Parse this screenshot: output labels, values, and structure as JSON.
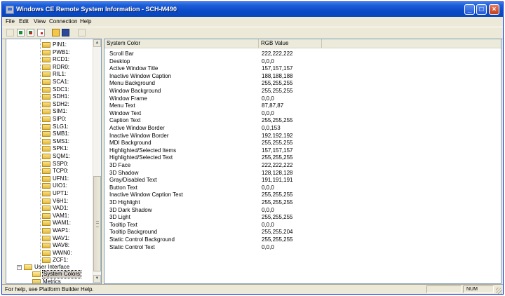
{
  "window": {
    "title": "Windows CE Remote System Information - SCH-M490",
    "controls": {
      "minimize": "_",
      "maximize": "□",
      "close": "×"
    },
    "titlebar_color": "#0a4ac8"
  },
  "menu": [
    {
      "label": "File"
    },
    {
      "label": "Edit"
    },
    {
      "label": "View"
    },
    {
      "label": "Connection"
    },
    {
      "label": "Help"
    }
  ],
  "toolbar": {
    "buttons": [
      "new-icon",
      "connect-icon",
      "disconnect-icon",
      "refresh-icon",
      "open-folder-icon",
      "save-icon",
      "copy-icon"
    ]
  },
  "tree": {
    "items": [
      "PIN1:",
      "PWB1:",
      "RCD1:",
      "RDR0:",
      "RIL1:",
      "SCA1:",
      "SDC1:",
      "SDH1:",
      "SDH2:",
      "SIM1:",
      "SIP0:",
      "SLG1:",
      "SMB1:",
      "SMS1:",
      "SPK1:",
      "SQM1:",
      "SSP0:",
      "TCP0:",
      "UFN1:",
      "UIO1:",
      "UPT1:",
      "V6H1:",
      "VAD1:",
      "VAM1:",
      "WAM1:",
      "WAP1:",
      "WAV1:",
      "WAV8:",
      "WWN0:",
      "ZCF1:"
    ],
    "group": {
      "label": "User Interface",
      "expander": "−"
    },
    "children": [
      {
        "label": "System Colors",
        "selected": true
      },
      {
        "label": "Metrics",
        "selected": false
      }
    ]
  },
  "list": {
    "columns": [
      "System Color",
      "RGB Value"
    ],
    "rows": [
      {
        "name": "Scroll Bar",
        "value": "222,222,222"
      },
      {
        "name": "Desktop",
        "value": "0,0,0"
      },
      {
        "name": "Active Window Title",
        "value": "157,157,157"
      },
      {
        "name": "Inactive Window Caption",
        "value": "188,188,188"
      },
      {
        "name": "Menu Background",
        "value": "255,255,255"
      },
      {
        "name": "Window Background",
        "value": "255,255,255"
      },
      {
        "name": "Window Frame",
        "value": "0,0,0"
      },
      {
        "name": "Menu Text",
        "value": "87,87,87"
      },
      {
        "name": "Window Text",
        "value": "0,0,0"
      },
      {
        "name": "Caption Text",
        "value": "255,255,255"
      },
      {
        "name": "Active Window Border",
        "value": "0,0,153"
      },
      {
        "name": "Inactive Window Border",
        "value": "192,192,192"
      },
      {
        "name": "MDI Background",
        "value": "255,255,255"
      },
      {
        "name": "Highlighted/Selected Items",
        "value": "157,157,157"
      },
      {
        "name": "Highlighted/Selected Text",
        "value": "255,255,255"
      },
      {
        "name": "3D Face",
        "value": "222,222,222"
      },
      {
        "name": "3D Shadow",
        "value": "128,128,128"
      },
      {
        "name": "Gray/Disabled Text",
        "value": "191,191,191"
      },
      {
        "name": "Button Text",
        "value": "0,0,0"
      },
      {
        "name": "Inactive Window Caption Text",
        "value": "255,255,255"
      },
      {
        "name": "3D Highlight",
        "value": "255,255,255"
      },
      {
        "name": "3D Dark Shadow",
        "value": "0,0,0"
      },
      {
        "name": "3D Light",
        "value": "255,255,255"
      },
      {
        "name": "Tooltip Text",
        "value": "0,0,0"
      },
      {
        "name": "Tooltip Background",
        "value": "255,255,204"
      },
      {
        "name": "Static Control Background",
        "value": "255,255,255"
      },
      {
        "name": "Static Control Text",
        "value": "0,0,0"
      }
    ]
  },
  "scrollbar": {
    "up": "▲",
    "down": "▼"
  },
  "status": {
    "text": "For help, see Platform Builder Help.",
    "num": "NUM"
  }
}
